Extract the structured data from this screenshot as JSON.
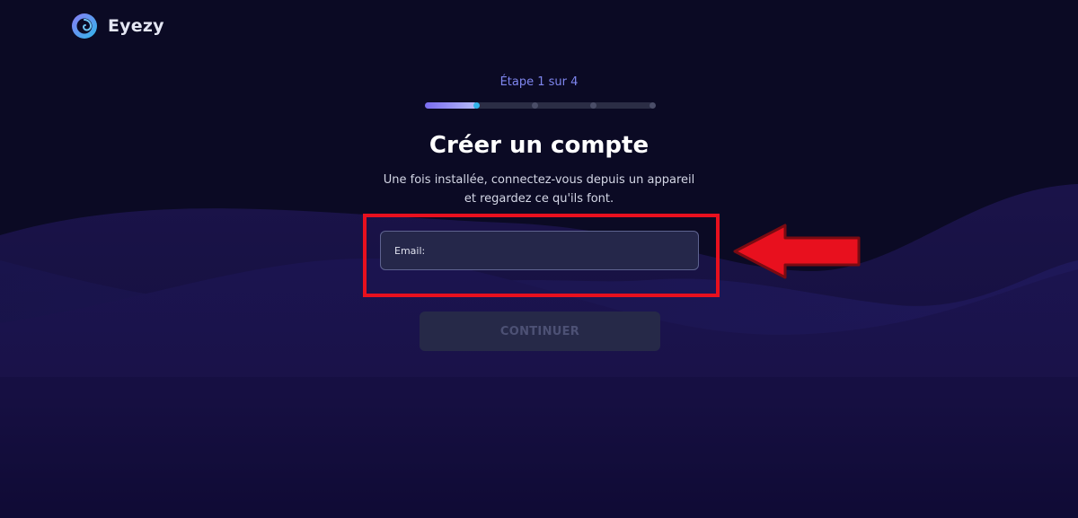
{
  "brand": {
    "name": "Eyezy",
    "logo_icon": "eye-swirl-logo"
  },
  "signup": {
    "step_label": "Étape 1 sur 4",
    "progress": {
      "current_step": 1,
      "total_steps": 4,
      "fill_fraction": 0.23
    },
    "title": "Créer un compte",
    "subtitle_line1": "Une fois installée, connectez-vous depuis un appareil",
    "subtitle_line2": "et regardez ce qu'ils font.",
    "email_placeholder": "Email:",
    "email_value": "",
    "continue_label": "CONTINUER"
  },
  "annotation": {
    "highlight_color": "#e8101e",
    "arrow_icon": "left-arrow-icon"
  },
  "colors": {
    "background": "#0b0a24",
    "accent": "#7f86ef",
    "progress_active_dot": "#31b3ea"
  }
}
